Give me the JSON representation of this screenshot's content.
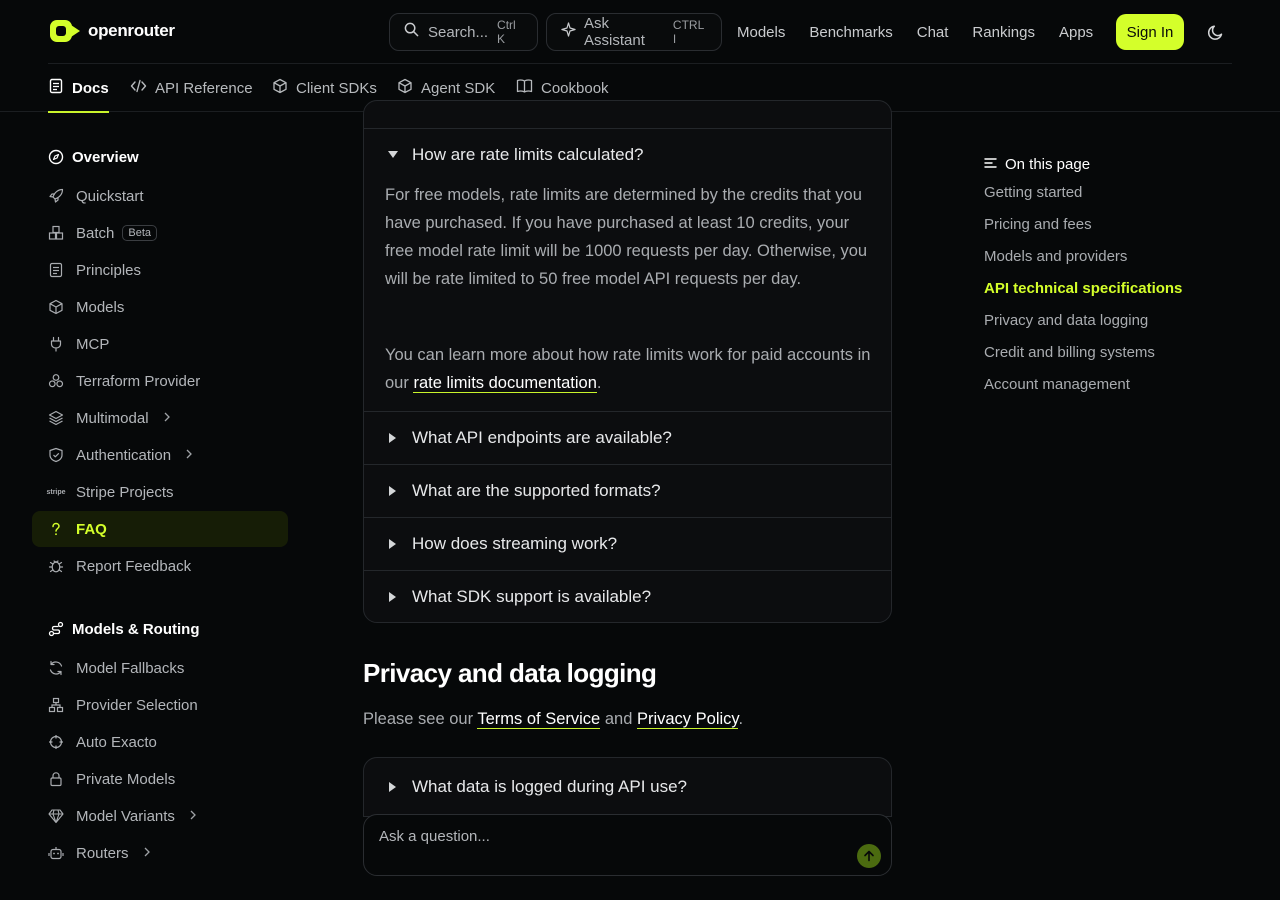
{
  "header": {
    "logo_text": "openrouter",
    "search": {
      "placeholder": "Search...",
      "shortcut": "Ctrl K"
    },
    "assistant": {
      "label": "Ask Assistant",
      "shortcut": "CTRL I"
    },
    "nav": [
      "Models",
      "Benchmarks",
      "Chat",
      "Rankings",
      "Apps"
    ],
    "sign_in": "Sign In"
  },
  "tabs": [
    {
      "label": "Docs",
      "icon": "document-icon",
      "active": true
    },
    {
      "label": "API Reference",
      "icon": "code-icon"
    },
    {
      "label": "Client SDKs",
      "icon": "cube-icon"
    },
    {
      "label": "Agent SDK",
      "icon": "cube-icon"
    },
    {
      "label": "Cookbook",
      "icon": "book-icon"
    }
  ],
  "sidebar": {
    "overview": "Overview",
    "items": [
      {
        "label": "Quickstart",
        "icon": "rocket-icon"
      },
      {
        "label": "Batch",
        "icon": "boxes-icon",
        "badge": "Beta"
      },
      {
        "label": "Principles",
        "icon": "document-icon"
      },
      {
        "label": "Models",
        "icon": "cube-icon"
      },
      {
        "label": "MCP",
        "icon": "plug-icon"
      },
      {
        "label": "Terraform Provider",
        "icon": "stack-icon"
      },
      {
        "label": "Multimodal",
        "icon": "layers-icon",
        "chevron": true
      },
      {
        "label": "Authentication",
        "icon": "shield-icon",
        "chevron": true
      },
      {
        "label": "Stripe Projects",
        "icon": "stripe-icon",
        "icon_text": "stripe"
      },
      {
        "label": "FAQ",
        "icon": "question-icon",
        "active": true
      },
      {
        "label": "Report Feedback",
        "icon": "bug-icon"
      }
    ],
    "routing_group": "Models & Routing",
    "routing_items": [
      {
        "label": "Model Fallbacks",
        "icon": "refresh-icon"
      },
      {
        "label": "Provider Selection",
        "icon": "network-icon"
      },
      {
        "label": "Auto Exacto",
        "icon": "crosshair-icon"
      },
      {
        "label": "Private Models",
        "icon": "lock-icon"
      },
      {
        "label": "Model Variants",
        "icon": "gem-icon",
        "chevron": true
      },
      {
        "label": "Routers",
        "icon": "robot-icon",
        "chevron": true
      }
    ]
  },
  "faq": {
    "open_question": "How are rate limits calculated?",
    "answer_p1": "For free models, rate limits are determined by the credits that you have purchased. If you have purchased at least 10 credits, your free model rate limit will be 1000 requests per day. Otherwise, you will be rate limited to 50 free model API requests per day.",
    "answer_p2_prefix": "You can learn more about how rate limits work for paid accounts in our",
    "answer_p2_link": "rate limits documentation",
    "answer_p2_suffix": ".",
    "closed_questions": [
      "What API endpoints are available?",
      "What are the supported formats?",
      "How does streaming work?",
      "What SDK support is available?"
    ]
  },
  "privacy": {
    "title": "Privacy and data logging",
    "para_prefix": "Please see our",
    "terms_link": "Terms of Service",
    "and": "and",
    "privacy_link": "Privacy Policy",
    "para_suffix": ".",
    "question": "What data is logged during API use?"
  },
  "ask": {
    "placeholder": "Ask a question..."
  },
  "toc": {
    "title": "On this page",
    "items": [
      {
        "label": "Getting started"
      },
      {
        "label": "Pricing and fees"
      },
      {
        "label": "Models and providers"
      },
      {
        "label": "API technical specifications",
        "active": true
      },
      {
        "label": "Privacy and data logging"
      },
      {
        "label": "Credit and billing systems"
      },
      {
        "label": "Account management"
      }
    ]
  },
  "colors": {
    "accent": "#d4ff2a",
    "background": "#060809",
    "card": "#0c0d0f",
    "border": "#24272b"
  }
}
